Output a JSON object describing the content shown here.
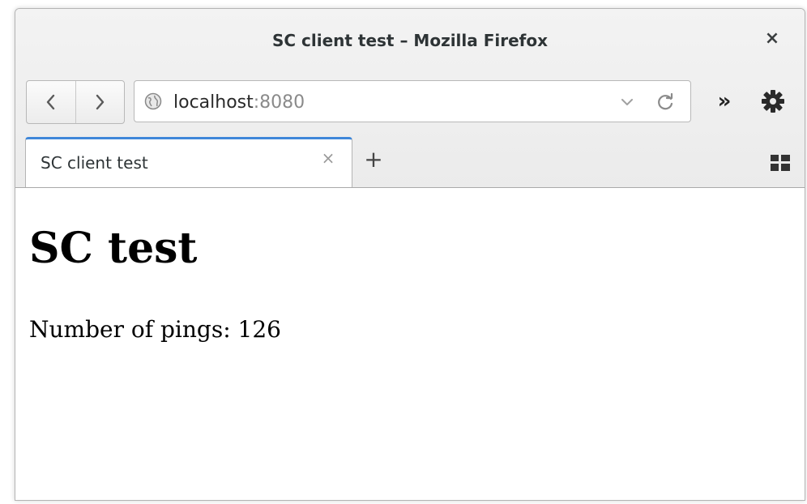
{
  "window": {
    "title": "SC client test – Mozilla Firefox",
    "close_symbol": "×"
  },
  "toolbar": {
    "back_icon": "back-arrow-icon",
    "forward_icon": "forward-arrow-icon",
    "url_host": "localhost",
    "url_port": ":8080",
    "overflow_symbol": "»",
    "menu_icon": "gear-icon"
  },
  "tabs": [
    {
      "label": "SC client test",
      "close_symbol": "×",
      "active": true
    }
  ],
  "new_tab_symbol": "+",
  "page": {
    "heading": "SC test",
    "pings_text": "Number of pings: 126"
  },
  "colors": {
    "accent": "#3f87d9",
    "chrome_bg": "#ebebeb",
    "port_text": "#8a8a8a"
  }
}
